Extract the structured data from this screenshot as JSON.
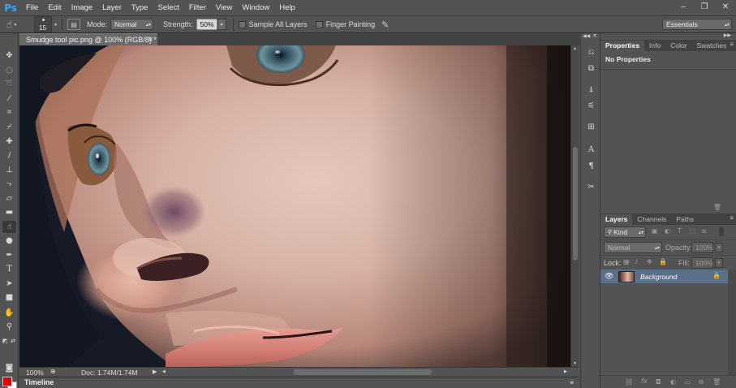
{
  "app": {
    "logo": "Ps"
  },
  "menu": [
    "File",
    "Edit",
    "Image",
    "Layer",
    "Type",
    "Select",
    "Filter",
    "View",
    "Window",
    "Help"
  ],
  "window_controls": {
    "minimize": "–",
    "restore": "❐",
    "close": "✕"
  },
  "options": {
    "brush_size": "15",
    "mode_label": "Mode:",
    "mode_value": "Normal",
    "strength_label": "Strength:",
    "strength_value": "50%",
    "sample_all_layers": "Sample All Layers",
    "finger_painting": "Finger Painting",
    "workspace": "Essentials"
  },
  "document": {
    "tab_title": "Smudge tool pic.png @ 100% (RGB/8) *",
    "zoom": "100%",
    "doc_size": "Doc: 1.74M/1.74M"
  },
  "timeline_label": "Timeline",
  "colors": {
    "foreground": "#e00000",
    "background": "#ffffff",
    "accent": "#31a8ff",
    "selected_layer": "#5a6f88"
  },
  "properties_panel": {
    "tabs": [
      "Properties",
      "Info",
      "Color",
      "Swatches"
    ],
    "active_tab": "Properties",
    "message": "No Properties"
  },
  "layers_panel": {
    "tabs": [
      "Layers",
      "Channels",
      "Paths"
    ],
    "active_tab": "Layers",
    "filter_kind": "Kind",
    "blend_mode": "Normal",
    "opacity_label": "Opacity:",
    "opacity_value": "100%",
    "lock_label": "Lock:",
    "fill_label": "Fill:",
    "fill_value": "100%",
    "layers": [
      {
        "name": "Background",
        "visible": true,
        "locked": true
      }
    ]
  }
}
